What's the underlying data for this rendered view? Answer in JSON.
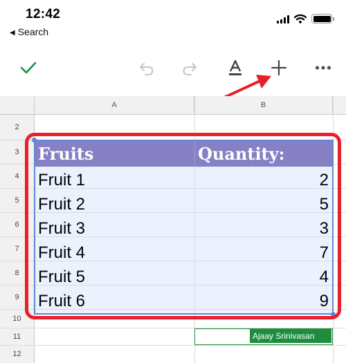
{
  "status_bar": {
    "time": "12:42",
    "back_label": "Search"
  },
  "toolbar": {
    "icons": [
      "checkmark-icon",
      "undo-icon",
      "redo-icon",
      "text-format-icon",
      "add-icon",
      "more-icon"
    ]
  },
  "sheet": {
    "columns": [
      "A",
      "B"
    ],
    "row_numbers": [
      "2",
      "3",
      "4",
      "5",
      "6",
      "7",
      "8",
      "9",
      "10",
      "11",
      "12"
    ],
    "header": {
      "a": "Fruits",
      "b": "Quantity:"
    },
    "rows": [
      {
        "name": "Fruit 1",
        "qty": "2"
      },
      {
        "name": "Fruit 2",
        "qty": "5"
      },
      {
        "name": "Fruit 3",
        "qty": "3"
      },
      {
        "name": "Fruit 4",
        "qty": "7"
      },
      {
        "name": "Fruit 5",
        "qty": "4"
      },
      {
        "name": "Fruit 6",
        "qty": "9"
      }
    ],
    "collaborator": "Ajaay Srinivasan"
  },
  "colors": {
    "header_fill": "#6451a8",
    "accent_check": "#1e8e3e",
    "annotation_red": "#e8202a",
    "selection_blue": "#5b88d6"
  }
}
